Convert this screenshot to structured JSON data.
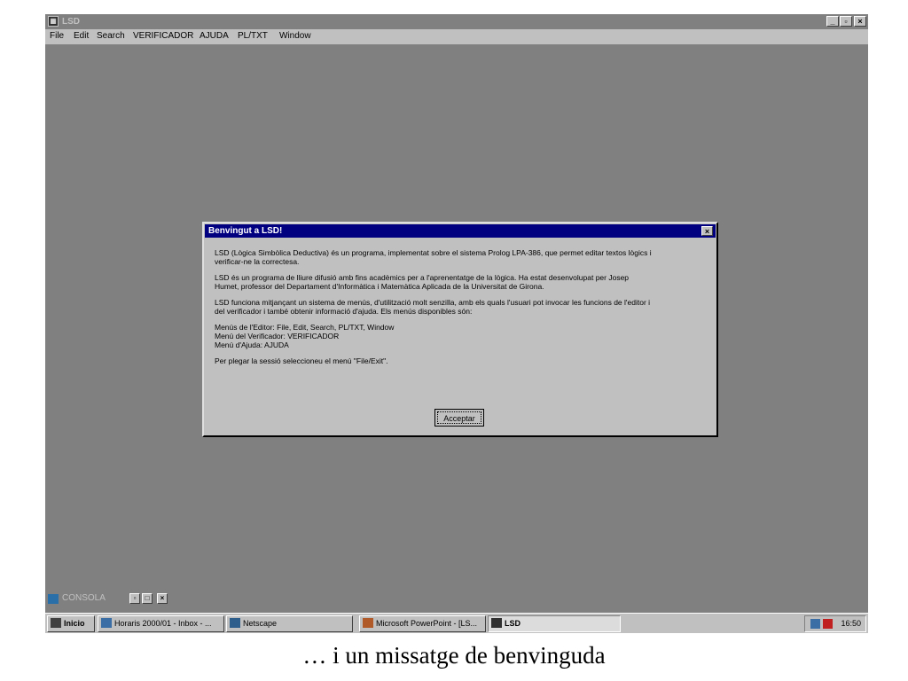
{
  "window": {
    "title": "LSD",
    "icon": "lsd-app-icon",
    "controls": [
      "_",
      "▫",
      "×"
    ]
  },
  "menu": [
    "File",
    "Edit",
    "Search",
    "VERIFICADOR",
    "AJUDA",
    "PL/TXT",
    "Window"
  ],
  "dialog": {
    "title": "Benvingut a LSD!",
    "close": "×",
    "paragraphs": [
      "LSD (Lògica Simbòlica Deductiva) és un programa, implementat sobre el sistema Prolog LPA-386, que permet editar textos lògics i\nverificar-ne la correctesa.",
      "LSD és un programa de lliure difusió amb fins acadèmics per a l'aprenentatge de la lògica. Ha estat desenvolupat per Josep\nHumet, professor del Departament d'Informàtica i Matemàtica Aplicada de la Universitat de Girona.",
      "LSD funciona mitjançant un sistema de menús, d'utilització molt senzilla, amb els quals l'usuari pot invocar les funcions de l'editor i\ndel verificador i també obtenir informació d'ajuda. Els menús disponibles són:",
      "Menús de l'Editor: File, Edit, Search, PL/TXT, Window\nMenú del Verificador: VERIFICADOR\nMenú d'Ajuda: AJUDA",
      "Per plegar la sessió seleccioneu el menú \"File/Exit\"."
    ],
    "ok_label": "Acceptar"
  },
  "consola": {
    "label": "CONSOLA",
    "controls": [
      "▫",
      "□",
      "×"
    ]
  },
  "taskbar": {
    "start": "Inicio",
    "buttons": [
      {
        "label": "Horaris 2000/01 - Inbox - ...",
        "icon": "mail-icon"
      },
      {
        "label": "Netscape",
        "icon": "netscape-icon"
      },
      {
        "label": "Microsoft PowerPoint - [LS...",
        "icon": "powerpoint-icon"
      },
      {
        "label": "LSD",
        "icon": "lsd-app-icon",
        "active": true
      }
    ],
    "clock": "16:50"
  },
  "caption": "… i un missatge de benvinguda",
  "colors": {
    "desktop": "#808080",
    "dialog_title": "#000080",
    "face": "#c0c0c0"
  }
}
